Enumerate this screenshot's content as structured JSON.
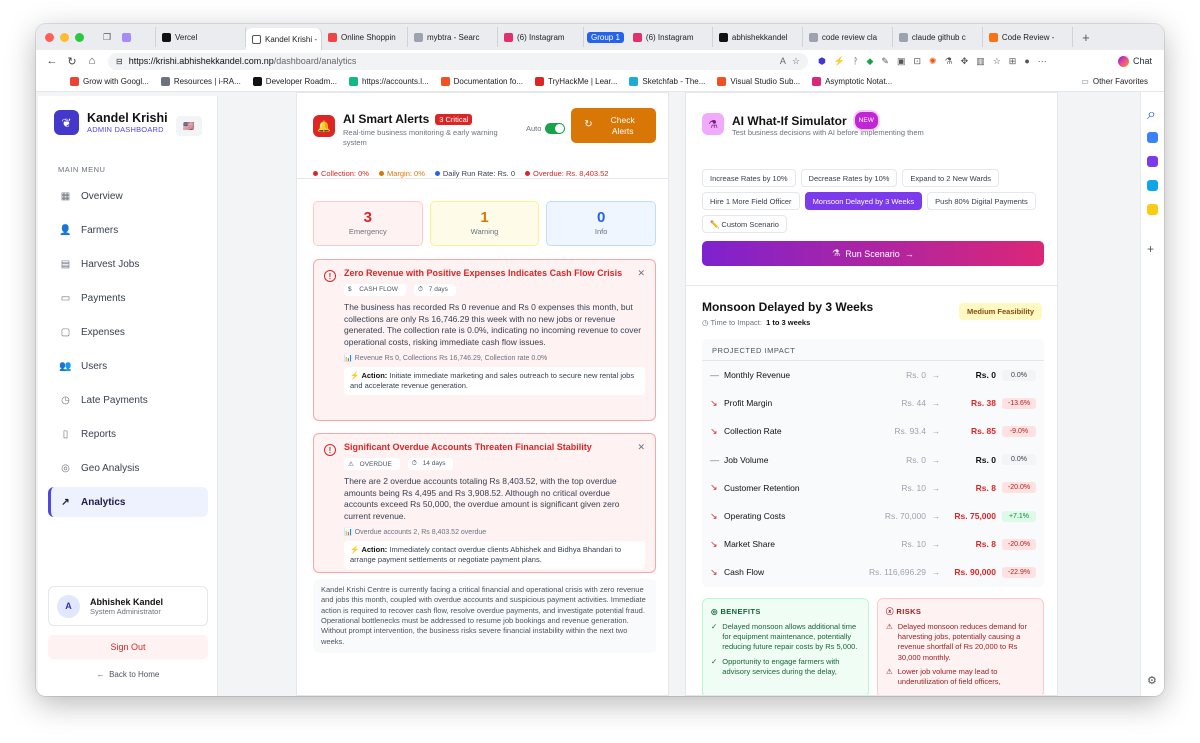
{
  "browser": {
    "tabs": [
      {
        "label": "",
        "color": "#a78bfa"
      },
      {
        "label": "Vercel",
        "color": "#111111"
      },
      {
        "label": "Kandel Krishi -",
        "color": "#ffffff",
        "active": true
      },
      {
        "label": "Online Shoppin",
        "color": "#ef4444"
      },
      {
        "label": "mybtra - Searc",
        "color": "#9ca3af"
      },
      {
        "label": "(6) Instagram",
        "color": "#e1306c"
      },
      {
        "label": "(6) Instagram",
        "color": "#e1306c"
      },
      {
        "label": "abhishekkandel",
        "color": "#111111"
      },
      {
        "label": "code review cla",
        "color": "#9ca3af"
      },
      {
        "label": "claude github c",
        "color": "#9ca3af"
      },
      {
        "label": "Code Review -",
        "color": "#f97316"
      }
    ],
    "group_label": "Group 1",
    "url_host": "https://krishi.abhishekkandel.com.np",
    "url_path": "/dashboard/analytics",
    "chat_label": "Chat",
    "bookmarks": [
      {
        "label": "Grow with Googl...",
        "color": "#ea4335"
      },
      {
        "label": "Resources | i-RA...",
        "color": "#6b7280"
      },
      {
        "label": "Developer Roadm...",
        "color": "#111111"
      },
      {
        "label": "https://accounts.l...",
        "color": "#10b981"
      },
      {
        "label": "Documentation fo...",
        "color": "#f25022"
      },
      {
        "label": "TryHackMe | Lear...",
        "color": "#dc2626"
      },
      {
        "label": "Sketchfab - The...",
        "color": "#1caad9"
      },
      {
        "label": "Visual Studio Sub...",
        "color": "#f25022"
      },
      {
        "label": "Asymptotic Notat...",
        "color": "#db2777"
      }
    ],
    "other_favorites": "Other Favorites"
  },
  "sidebar": {
    "brand_name": "Kandel Krishi",
    "brand_sub": "ADMIN DASHBOARD",
    "flag": "🇺🇸",
    "menu_heading": "MAIN MENU",
    "items": [
      {
        "label": "Overview",
        "icon": "▦"
      },
      {
        "label": "Farmers",
        "icon": "👤"
      },
      {
        "label": "Harvest Jobs",
        "icon": "▤"
      },
      {
        "label": "Payments",
        "icon": "▭"
      },
      {
        "label": "Expenses",
        "icon": "▢"
      },
      {
        "label": "Users",
        "icon": "👥"
      },
      {
        "label": "Late Payments",
        "icon": "◷"
      },
      {
        "label": "Reports",
        "icon": "▯"
      },
      {
        "label": "Geo Analysis",
        "icon": "◎"
      },
      {
        "label": "Analytics",
        "icon": "↗",
        "active": true
      }
    ],
    "user": {
      "initial": "A",
      "name": "Abhishek Kandel",
      "role": "System Administrator"
    },
    "sign_out": "Sign Out",
    "back_home": "Back to Home"
  },
  "alerts": {
    "title": "AI Smart Alerts",
    "critical_badge": "3 Critical",
    "subtitle": "Real-time business monitoring & early warning system",
    "auto_label": "Auto",
    "check_button": "Check Alerts",
    "status": {
      "collection": "Collection: 0%",
      "margin": "Margin: 0%",
      "run_rate": "Daily Run Rate: Rs. 0",
      "overdue": "Overdue: Rs. 8,403.52"
    },
    "counts": [
      {
        "value": "3",
        "label": "Emergency"
      },
      {
        "value": "1",
        "label": "Warning"
      },
      {
        "value": "0",
        "label": "Info"
      }
    ],
    "items": [
      {
        "title": "Zero Revenue with Positive Expenses Indicates Cash Flow Crisis",
        "tag": "CASH FLOW",
        "days": "7 days",
        "description": "The business has recorded Rs 0 revenue and Rs 0 expenses this month, but collections are only Rs 16,746.29 this week with no new jobs or revenue generated. The collection rate is 0.0%, indicating no incoming revenue to cover operational costs, risking immediate cash flow issues.",
        "metrics": "Revenue Rs 0, Collections Rs 16,746.29, Collection rate 0.0%",
        "action_label": "Action:",
        "action": "Initiate immediate marketing and sales outreach to secure new rental jobs and accelerate revenue generation."
      },
      {
        "title": "Significant Overdue Accounts Threaten Financial Stability",
        "tag": "OVERDUE",
        "days": "14 days",
        "description": "There are 2 overdue accounts totaling Rs 8,403.52, with the top overdue amounts being Rs 4,495 and Rs 3,908.52. Although no critical overdue accounts exceed Rs 50,000, the overdue amount is significant given zero current revenue.",
        "metrics": "Overdue accounts 2, Rs 8,403.52 overdue",
        "action_label": "Action:",
        "action": "Immediately contact overdue clients Abhishek and Bidhya Bhandari to arrange payment settlements or negotiate payment plans."
      }
    ],
    "summary": "Kandel Krishi Centre is currently facing a critical financial and operational crisis with zero revenue and jobs this month, coupled with overdue accounts and suspicious payment activities. Immediate action is required to recover cash flow, resolve overdue payments, and investigate potential fraud. Operational bottlenecks must be addressed to resume job bookings and revenue generation. Without prompt intervention, the business risks severe financial instability within the next two weeks."
  },
  "simulator": {
    "title": "AI What-If Simulator",
    "new_badge": "NEW",
    "subtitle": "Test business decisions with AI before implementing them",
    "scenarios": [
      {
        "label": "Increase Rates by 10%"
      },
      {
        "label": "Decrease Rates by 10%"
      },
      {
        "label": "Expand to 2 New Wards"
      },
      {
        "label": "Hire 1 More Field Officer"
      },
      {
        "label": "Monsoon Delayed by 3 Weeks",
        "selected": true
      },
      {
        "label": "Push 80% Digital Payments"
      },
      {
        "label": "✏️ Custom Scenario"
      }
    ],
    "run_button": "Run Scenario",
    "result_title": "Monsoon Delayed by 3 Weeks",
    "time_label": "Time to Impact:",
    "time_value": "1 to 3 weeks",
    "feasibility": "Medium Feasibility",
    "impact_heading": "PROJECTED IMPACT",
    "impact": [
      {
        "name": "Monthly Revenue",
        "old": "Rs. 0",
        "new": "Rs. 0",
        "pct": "0.0%",
        "trend": "flat"
      },
      {
        "name": "Profit Margin",
        "old": "Rs. 44",
        "new": "Rs. 38",
        "pct": "-13.6%",
        "trend": "down"
      },
      {
        "name": "Collection Rate",
        "old": "Rs. 93.4",
        "new": "Rs. 85",
        "pct": "-9.0%",
        "trend": "down"
      },
      {
        "name": "Job Volume",
        "old": "Rs. 0",
        "new": "Rs. 0",
        "pct": "0.0%",
        "trend": "flat"
      },
      {
        "name": "Customer Retention",
        "old": "Rs. 10",
        "new": "Rs. 8",
        "pct": "-20.0%",
        "trend": "down"
      },
      {
        "name": "Operating Costs",
        "old": "Rs. 70,000",
        "new": "Rs. 75,000",
        "pct": "+7.1%",
        "trend": "down"
      },
      {
        "name": "Market Share",
        "old": "Rs. 10",
        "new": "Rs. 8",
        "pct": "-20.0%",
        "trend": "down"
      },
      {
        "name": "Cash Flow",
        "old": "Rs. 116,696.29",
        "new": "Rs. 90,000",
        "pct": "-22.9%",
        "trend": "down"
      }
    ],
    "benefits_heading": "BENEFITS",
    "benefits": [
      "Delayed monsoon allows additional time for equipment maintenance, potentially reducing future repair costs by Rs 5,000.",
      "Opportunity to engage farmers with advisory services during the delay,"
    ],
    "risks_heading": "RISKS",
    "risks": [
      "Delayed monsoon reduces demand for harvesting jobs, potentially causing a revenue shortfall of Rs 20,000 to Rs 30,000 monthly.",
      "Lower job volume may lead to underutilization of field officers,"
    ]
  },
  "colors": {
    "primary": "#4f46e5",
    "danger": "#dc2626",
    "warning": "#d97706",
    "info": "#2563eb",
    "accent": "#7c3aed"
  }
}
